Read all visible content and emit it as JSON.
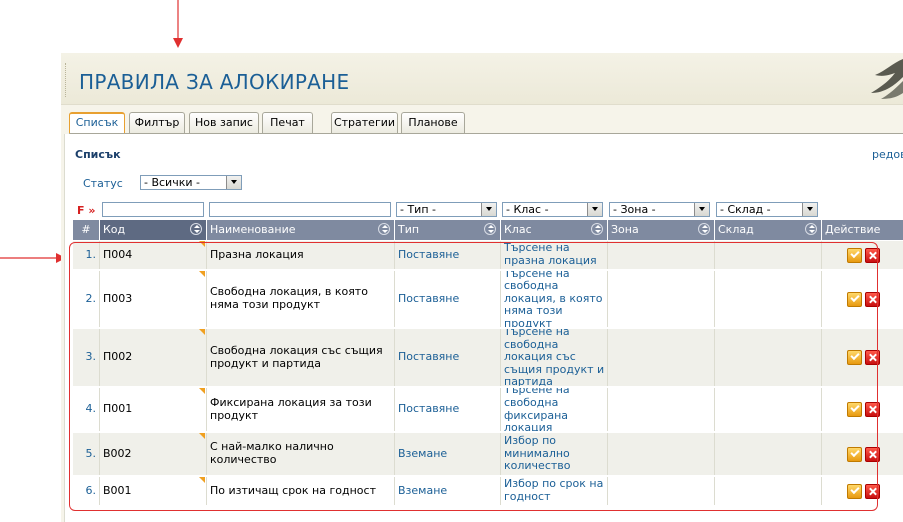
{
  "page": {
    "title": "ПРАВИЛА ЗА АЛОКИРАНЕ"
  },
  "tabs": [
    {
      "label": "Списък",
      "active": true
    },
    {
      "label": "Филтър",
      "active": false
    },
    {
      "label": "Нов запис",
      "active": false
    },
    {
      "label": "Печат",
      "active": false
    },
    {
      "label": "Стратегии",
      "active": false
    },
    {
      "label": "Планове",
      "active": false
    }
  ],
  "section": {
    "title": "Списък",
    "rows_label": "редове"
  },
  "status": {
    "label": "Статус",
    "value": "- Всички -"
  },
  "filters": {
    "marker": "F »",
    "code": "",
    "name": "",
    "type": "- Тип -",
    "class": "- Клас -",
    "zone": "- Зона -",
    "warehouse": "- Склад -"
  },
  "columns": {
    "num": "#",
    "code": "Код",
    "name": "Наименование",
    "type": "Тип",
    "class": "Клас",
    "zone": "Зона",
    "warehouse": "Склад",
    "action": "Действие"
  },
  "rows": [
    {
      "num": "1.",
      "code": "П004",
      "name": "Празна локация",
      "type": "Поставяне",
      "class": "Търсене на празна локация",
      "zone": "",
      "warehouse": ""
    },
    {
      "num": "2.",
      "code": "П003",
      "name": "Свободна локация, в която няма този продукт",
      "type": "Поставяне",
      "class": "Търсене на свободна локация, в която няма този продукт",
      "zone": "",
      "warehouse": ""
    },
    {
      "num": "3.",
      "code": "П002",
      "name": "Свободна локация със същия продукт и партида",
      "type": "Поставяне",
      "class": "Търсене на свободна локация със същия продукт и партида",
      "zone": "",
      "warehouse": ""
    },
    {
      "num": "4.",
      "code": "П001",
      "name": "Фиксирана локация за този продукт",
      "type": "Поставяне",
      "class": "Търсене на свободна фиксирана локация",
      "zone": "",
      "warehouse": ""
    },
    {
      "num": "5.",
      "code": "В002",
      "name": "С най-малко налично количество",
      "type": "Вземане",
      "class": "Избор по минимално количество",
      "zone": "",
      "warehouse": ""
    },
    {
      "num": "6.",
      "code": "В001",
      "name": "По изтичащ срок на годност",
      "type": "Вземане",
      "class": "Избор по срок на годност",
      "zone": "",
      "warehouse": ""
    }
  ],
  "icons": {
    "edit": "edit-check-icon",
    "delete": "delete-x-icon",
    "arrow": "annotation-arrow-icon"
  },
  "colors": {
    "accent": "#1b5f96",
    "header": "#7f8aa0",
    "annotation": "#e03030",
    "tab_active": "#e8a030"
  }
}
